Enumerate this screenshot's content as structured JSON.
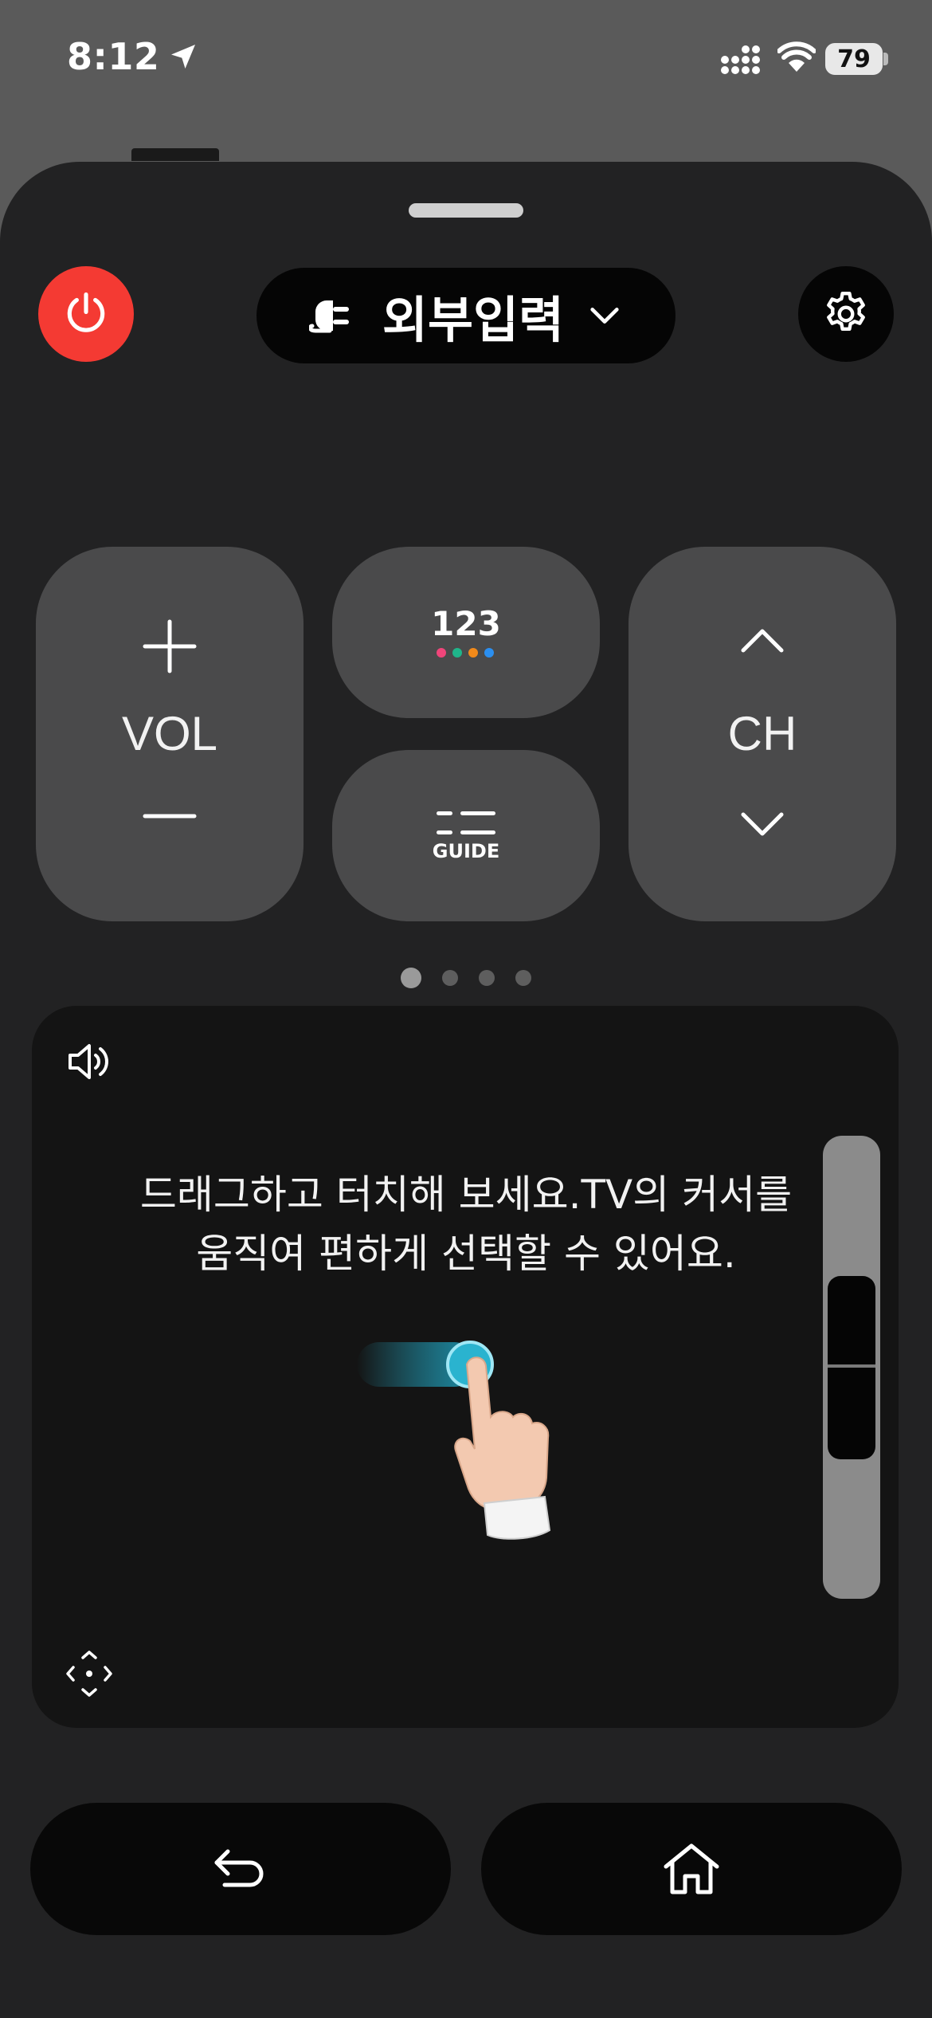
{
  "status_bar": {
    "time": "8:12",
    "battery": "79"
  },
  "header": {
    "input_label": "외부입력"
  },
  "pads": {
    "vol_label": "VOL",
    "ch_label": "CH",
    "numbers_label": "123",
    "guide_label": "GUIDE"
  },
  "touchpad": {
    "hint_line1": "드래그하고 터치해 보세요.TV의 커서를",
    "hint_line2": "움직여 편하게 선택할 수 있어요."
  },
  "colors": {
    "power": "#f43a33",
    "dot_pink": "#f0457a",
    "dot_green": "#1fb58a",
    "dot_orange": "#f28a1a",
    "dot_blue": "#2b8ff0",
    "touch_accent": "#2ab3cf"
  },
  "icons": {
    "location": "location-arrow-icon",
    "signal": "cellular-signal-icon",
    "wifi": "wifi-icon",
    "power": "power-icon",
    "input": "input-plug-icon",
    "chevron": "chevron-down-icon",
    "settings": "gear-icon",
    "volume": "speaker-icon",
    "dpad": "dpad-icon",
    "back": "back-arrow-icon",
    "home": "home-icon"
  },
  "pager": {
    "page_count": 4,
    "active_index": 0
  }
}
